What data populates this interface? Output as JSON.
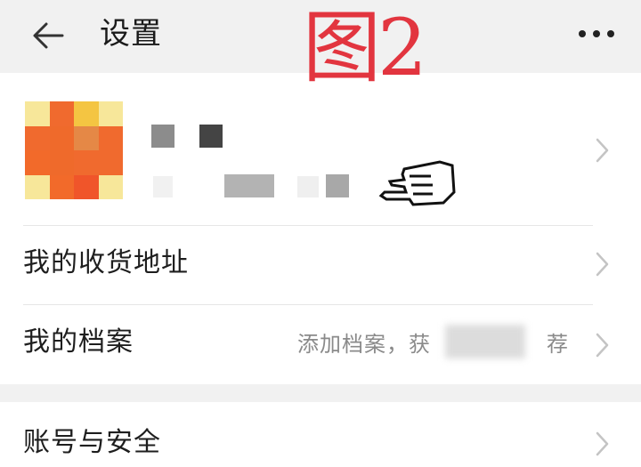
{
  "header": {
    "title": "设置",
    "overlay_label": "图2"
  },
  "icons": {
    "back": "arrow-left-icon",
    "more": "more-dots-icon",
    "chevron": "chevron-right-icon",
    "hand": "pointing-hand-icon"
  },
  "menu": {
    "items": [
      {
        "label": "我的收货地址",
        "hint": ""
      },
      {
        "label": "我的档案",
        "hint": "添加档案，获"
      },
      {
        "label": "账号与安全",
        "hint": ""
      }
    ],
    "hint_tail": "荐"
  },
  "colors": {
    "header_bg": "#f1f1f1",
    "overlay_red": "#e2353f",
    "text_primary": "#1e1e1e",
    "text_secondary": "#8a8a8a",
    "avatar_orange": "#f0672e",
    "avatar_yellow": "#f4c542"
  }
}
